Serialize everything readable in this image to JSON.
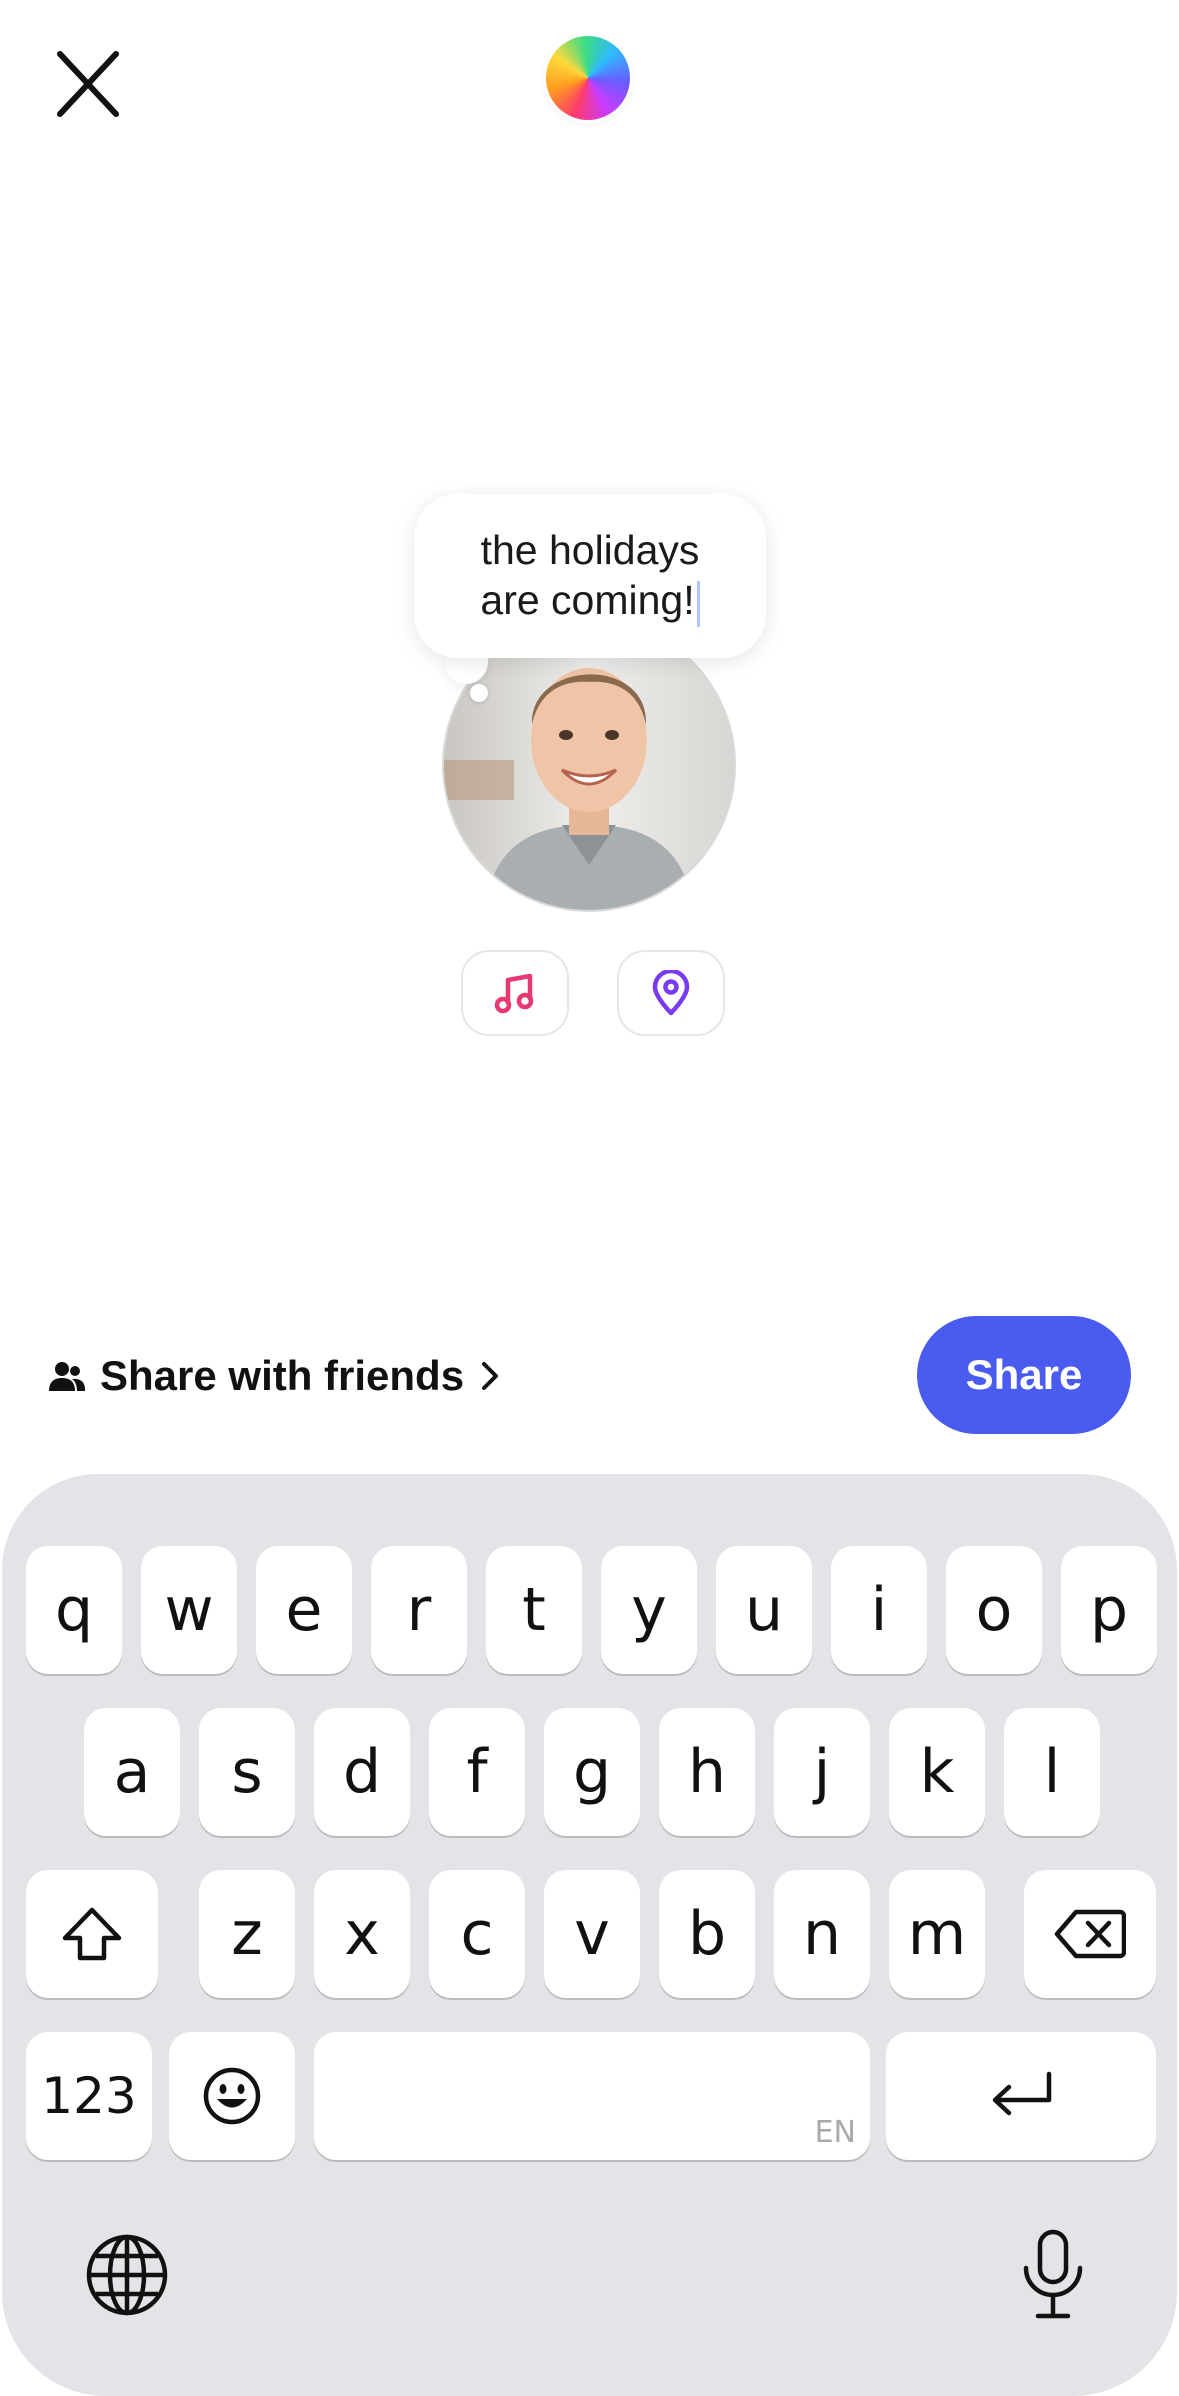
{
  "header": {
    "close_icon": "close-icon",
    "color_orb": "color-picker-orb"
  },
  "note_bubble": {
    "line1": "the holidays",
    "line2": "are coming!"
  },
  "avatar": {
    "description_icon": "profile-photo"
  },
  "attachments": [
    {
      "icon": "music-note-icon",
      "color": "#e5396f"
    },
    {
      "icon": "location-pin-icon",
      "color": "#7a3cf0"
    }
  ],
  "share_bar": {
    "audience_label": "Share with friends",
    "audience_icon": "people-icon",
    "chevron_icon": "chevron-right-icon",
    "share_label": "Share",
    "accent": "#4a5cf0"
  },
  "keyboard": {
    "row1": [
      "q",
      "w",
      "e",
      "r",
      "t",
      "y",
      "u",
      "i",
      "o",
      "p"
    ],
    "row2": [
      "a",
      "s",
      "d",
      "f",
      "g",
      "h",
      "j",
      "k",
      "l"
    ],
    "row3": [
      "z",
      "x",
      "c",
      "v",
      "b",
      "n",
      "m"
    ],
    "numbers_label": "123",
    "language_tag": "EN",
    "icons": [
      "shift-icon",
      "backspace-icon",
      "emoji-icon",
      "return-icon",
      "globe-icon",
      "microphone-icon"
    ]
  }
}
